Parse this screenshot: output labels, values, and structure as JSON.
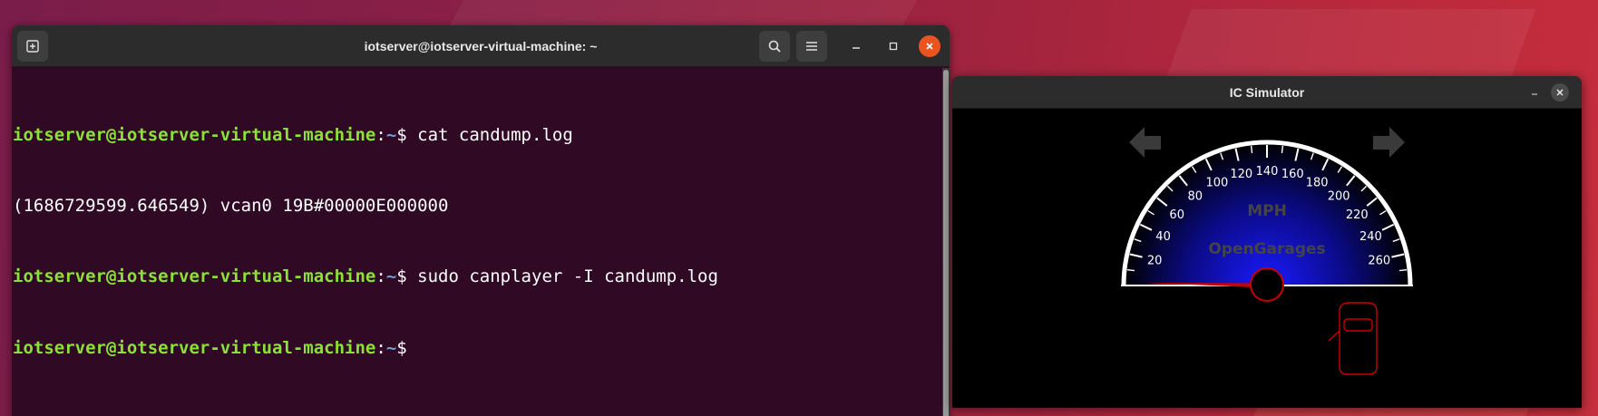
{
  "terminal": {
    "title": "iotserver@iotserver-virtual-machine: ~",
    "lines": [
      {
        "user": "iotserver@iotserver-virtual-machine",
        "sep": ":",
        "path": "~",
        "prompt": "$ ",
        "cmd": "cat candump.log"
      },
      {
        "output": "(1686729599.646549) vcan0 19B#00000E000000"
      },
      {
        "user": "iotserver@iotserver-virtual-machine",
        "sep": ":",
        "path": "~",
        "prompt": "$ ",
        "cmd": "sudo canplayer -I candump.log"
      },
      {
        "user": "iotserver@iotserver-virtual-machine",
        "sep": ":",
        "path": "~",
        "prompt": "$",
        "cmd": ""
      }
    ],
    "icons": {
      "new_tab": "new-tab-icon",
      "search": "search-icon",
      "menu": "hamburger-menu-icon",
      "minimize": "minimize-icon",
      "maximize": "maximize-icon",
      "close": "close-icon"
    }
  },
  "simulator": {
    "title": "IC Simulator",
    "speedometer": {
      "unit_label": "MPH",
      "brand_label": "OpenGarages",
      "tick_labels": [
        "20",
        "40",
        "60",
        "80",
        "100",
        "120",
        "140",
        "160",
        "180",
        "200",
        "220",
        "240",
        "260"
      ],
      "min": 0,
      "max": 280,
      "speed": 2
    },
    "left_signal_on": false,
    "right_signal_on": false,
    "door_open": "front-left",
    "colors": {
      "needle": "#cc0000",
      "dial_inner": "#1a1aff",
      "dial_outer": "#000000",
      "signal_off": "#3a3a3a",
      "car_outline": "#cc0000",
      "label": "#444444"
    }
  }
}
